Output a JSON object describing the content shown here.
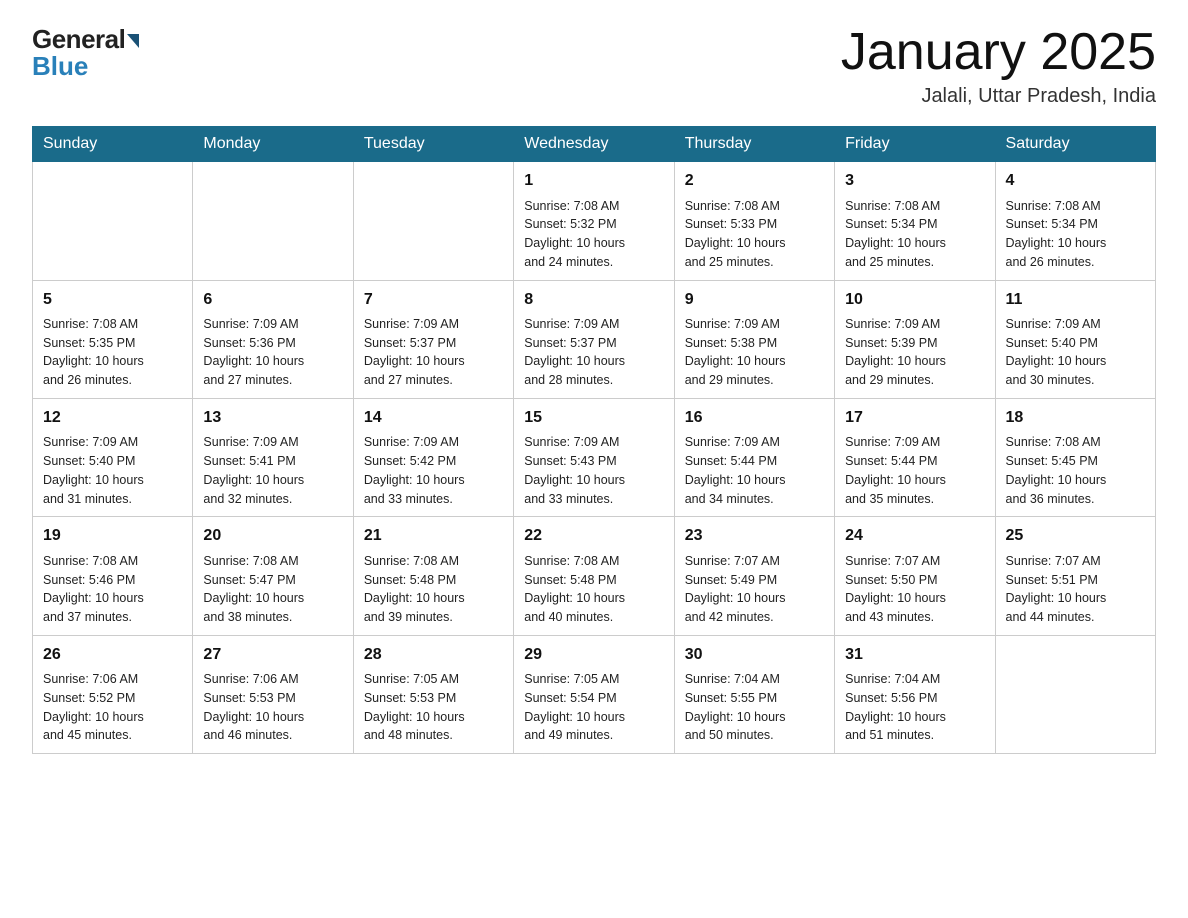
{
  "header": {
    "logo_general": "General",
    "logo_blue": "Blue",
    "month_title": "January 2025",
    "location": "Jalali, Uttar Pradesh, India"
  },
  "days_of_week": [
    "Sunday",
    "Monday",
    "Tuesday",
    "Wednesday",
    "Thursday",
    "Friday",
    "Saturday"
  ],
  "weeks": [
    [
      {
        "day": "",
        "info": ""
      },
      {
        "day": "",
        "info": ""
      },
      {
        "day": "",
        "info": ""
      },
      {
        "day": "1",
        "info": "Sunrise: 7:08 AM\nSunset: 5:32 PM\nDaylight: 10 hours\nand 24 minutes."
      },
      {
        "day": "2",
        "info": "Sunrise: 7:08 AM\nSunset: 5:33 PM\nDaylight: 10 hours\nand 25 minutes."
      },
      {
        "day": "3",
        "info": "Sunrise: 7:08 AM\nSunset: 5:34 PM\nDaylight: 10 hours\nand 25 minutes."
      },
      {
        "day": "4",
        "info": "Sunrise: 7:08 AM\nSunset: 5:34 PM\nDaylight: 10 hours\nand 26 minutes."
      }
    ],
    [
      {
        "day": "5",
        "info": "Sunrise: 7:08 AM\nSunset: 5:35 PM\nDaylight: 10 hours\nand 26 minutes."
      },
      {
        "day": "6",
        "info": "Sunrise: 7:09 AM\nSunset: 5:36 PM\nDaylight: 10 hours\nand 27 minutes."
      },
      {
        "day": "7",
        "info": "Sunrise: 7:09 AM\nSunset: 5:37 PM\nDaylight: 10 hours\nand 27 minutes."
      },
      {
        "day": "8",
        "info": "Sunrise: 7:09 AM\nSunset: 5:37 PM\nDaylight: 10 hours\nand 28 minutes."
      },
      {
        "day": "9",
        "info": "Sunrise: 7:09 AM\nSunset: 5:38 PM\nDaylight: 10 hours\nand 29 minutes."
      },
      {
        "day": "10",
        "info": "Sunrise: 7:09 AM\nSunset: 5:39 PM\nDaylight: 10 hours\nand 29 minutes."
      },
      {
        "day": "11",
        "info": "Sunrise: 7:09 AM\nSunset: 5:40 PM\nDaylight: 10 hours\nand 30 minutes."
      }
    ],
    [
      {
        "day": "12",
        "info": "Sunrise: 7:09 AM\nSunset: 5:40 PM\nDaylight: 10 hours\nand 31 minutes."
      },
      {
        "day": "13",
        "info": "Sunrise: 7:09 AM\nSunset: 5:41 PM\nDaylight: 10 hours\nand 32 minutes."
      },
      {
        "day": "14",
        "info": "Sunrise: 7:09 AM\nSunset: 5:42 PM\nDaylight: 10 hours\nand 33 minutes."
      },
      {
        "day": "15",
        "info": "Sunrise: 7:09 AM\nSunset: 5:43 PM\nDaylight: 10 hours\nand 33 minutes."
      },
      {
        "day": "16",
        "info": "Sunrise: 7:09 AM\nSunset: 5:44 PM\nDaylight: 10 hours\nand 34 minutes."
      },
      {
        "day": "17",
        "info": "Sunrise: 7:09 AM\nSunset: 5:44 PM\nDaylight: 10 hours\nand 35 minutes."
      },
      {
        "day": "18",
        "info": "Sunrise: 7:08 AM\nSunset: 5:45 PM\nDaylight: 10 hours\nand 36 minutes."
      }
    ],
    [
      {
        "day": "19",
        "info": "Sunrise: 7:08 AM\nSunset: 5:46 PM\nDaylight: 10 hours\nand 37 minutes."
      },
      {
        "day": "20",
        "info": "Sunrise: 7:08 AM\nSunset: 5:47 PM\nDaylight: 10 hours\nand 38 minutes."
      },
      {
        "day": "21",
        "info": "Sunrise: 7:08 AM\nSunset: 5:48 PM\nDaylight: 10 hours\nand 39 minutes."
      },
      {
        "day": "22",
        "info": "Sunrise: 7:08 AM\nSunset: 5:48 PM\nDaylight: 10 hours\nand 40 minutes."
      },
      {
        "day": "23",
        "info": "Sunrise: 7:07 AM\nSunset: 5:49 PM\nDaylight: 10 hours\nand 42 minutes."
      },
      {
        "day": "24",
        "info": "Sunrise: 7:07 AM\nSunset: 5:50 PM\nDaylight: 10 hours\nand 43 minutes."
      },
      {
        "day": "25",
        "info": "Sunrise: 7:07 AM\nSunset: 5:51 PM\nDaylight: 10 hours\nand 44 minutes."
      }
    ],
    [
      {
        "day": "26",
        "info": "Sunrise: 7:06 AM\nSunset: 5:52 PM\nDaylight: 10 hours\nand 45 minutes."
      },
      {
        "day": "27",
        "info": "Sunrise: 7:06 AM\nSunset: 5:53 PM\nDaylight: 10 hours\nand 46 minutes."
      },
      {
        "day": "28",
        "info": "Sunrise: 7:05 AM\nSunset: 5:53 PM\nDaylight: 10 hours\nand 48 minutes."
      },
      {
        "day": "29",
        "info": "Sunrise: 7:05 AM\nSunset: 5:54 PM\nDaylight: 10 hours\nand 49 minutes."
      },
      {
        "day": "30",
        "info": "Sunrise: 7:04 AM\nSunset: 5:55 PM\nDaylight: 10 hours\nand 50 minutes."
      },
      {
        "day": "31",
        "info": "Sunrise: 7:04 AM\nSunset: 5:56 PM\nDaylight: 10 hours\nand 51 minutes."
      },
      {
        "day": "",
        "info": ""
      }
    ]
  ]
}
